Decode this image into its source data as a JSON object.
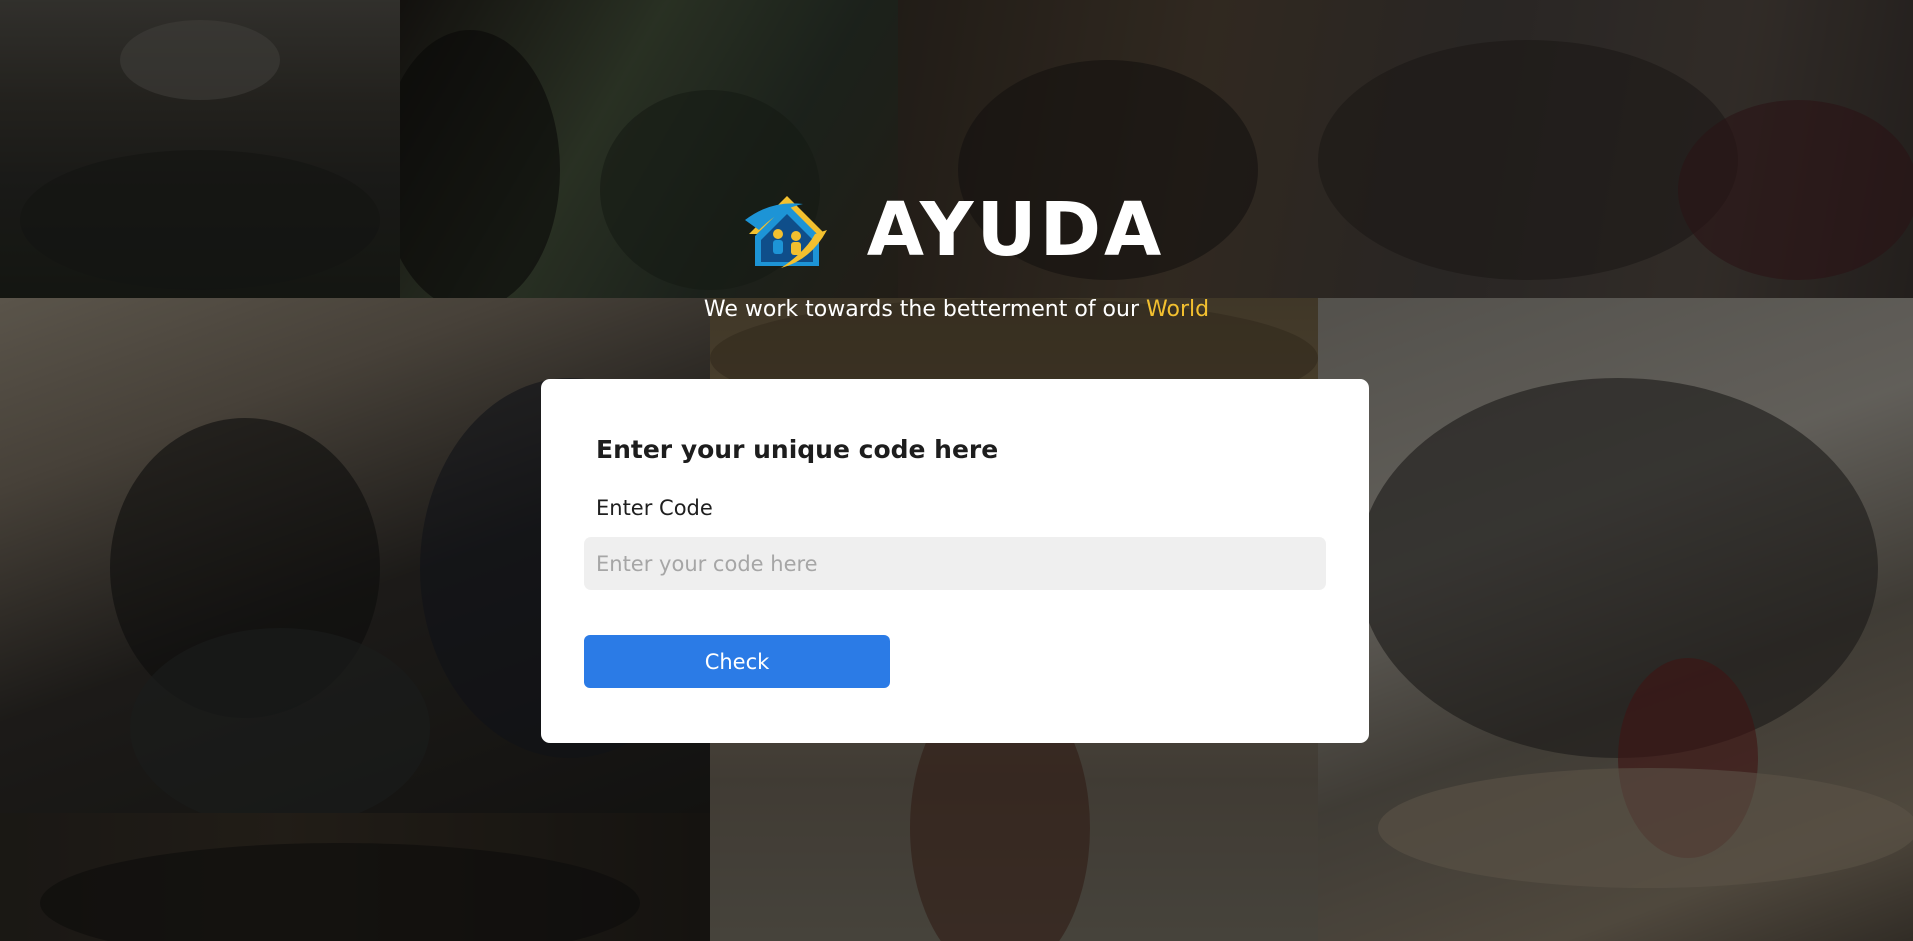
{
  "brand": {
    "name": "AYUDA",
    "logo_icon": "house-with-children-icon"
  },
  "tagline": {
    "text": "We work towards the betterment of our",
    "accent": "World",
    "accent_color": "#f3c02f"
  },
  "card": {
    "title": "Enter your unique code here",
    "field_label": "Enter Code",
    "input": {
      "value": "",
      "placeholder": "Enter your code here"
    },
    "button_label": "Check",
    "button_color": "#2b7be6"
  }
}
